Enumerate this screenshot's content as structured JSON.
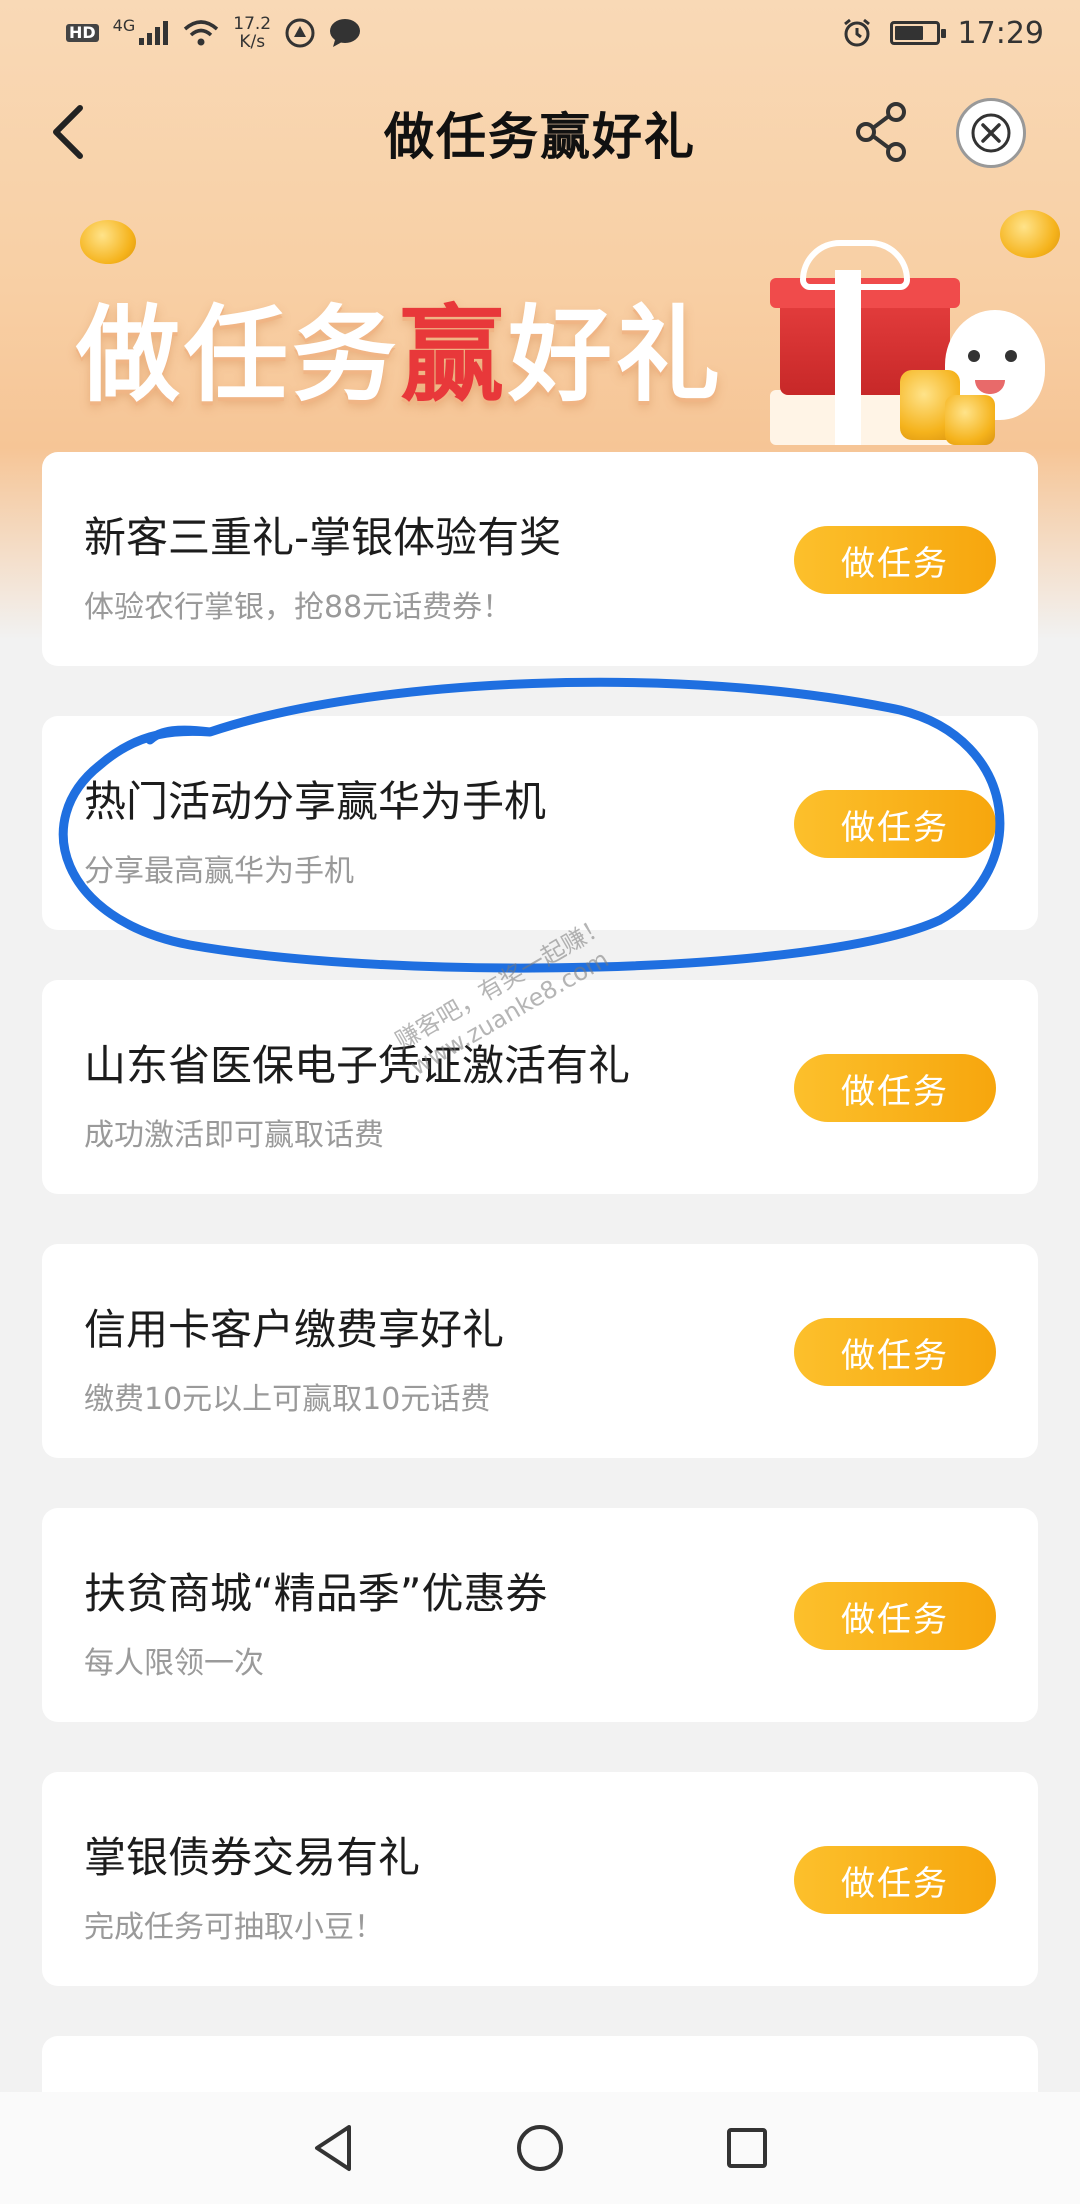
{
  "status_bar": {
    "network_badge": "HD",
    "network_type": "4G",
    "speed_value": "17.2",
    "speed_unit": "K/s",
    "time": "17:29",
    "battery_level": 0.7
  },
  "nav": {
    "title": "做任务赢好礼"
  },
  "banner": {
    "text_part1": "做任务",
    "text_highlight": "赢",
    "text_part2": "好礼"
  },
  "tasks": [
    {
      "title": "新客三重礼-掌银体验有奖",
      "subtitle": "体验农行掌银，抢88元话费券！",
      "button": "做任务"
    },
    {
      "title": "热门活动分享赢华为手机",
      "subtitle": "分享最高赢华为手机",
      "button": "做任务"
    },
    {
      "title": "山东省医保电子凭证激活有礼",
      "subtitle": "成功激活即可赢取话费",
      "button": "做任务"
    },
    {
      "title": "信用卡客户缴费享好礼",
      "subtitle": "缴费10元以上可赢取10元话费",
      "button": "做任务"
    },
    {
      "title": "扶贫商城“精品季”优惠券",
      "subtitle": "每人限领一次",
      "button": "做任务"
    },
    {
      "title": "掌银债券交易有礼",
      "subtitle": "完成任务可抽取小豆！",
      "button": "做任务"
    }
  ],
  "watermark": {
    "line1": "赚客吧，有奖一起赚！",
    "line2": "www.zuanke8.com"
  },
  "colors": {
    "accent": "#f7a60d",
    "highlight_ring": "#1f6fe0",
    "banner_red": "#e8383a"
  }
}
